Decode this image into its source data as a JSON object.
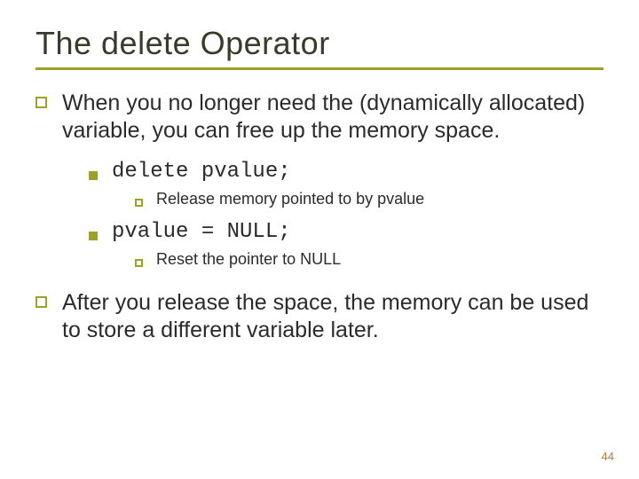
{
  "title": "The delete Operator",
  "point1": "When you no longer need the (dynamically allocated) variable, you can free up the memory space.",
  "code1": "delete pvalue;",
  "note1": "Release memory pointed to by pvalue",
  "code2": "pvalue = NULL;",
  "note2": "Reset the pointer to NULL",
  "point2": "After you release the space, the memory can be used to store a different variable later.",
  "page_number": "44"
}
